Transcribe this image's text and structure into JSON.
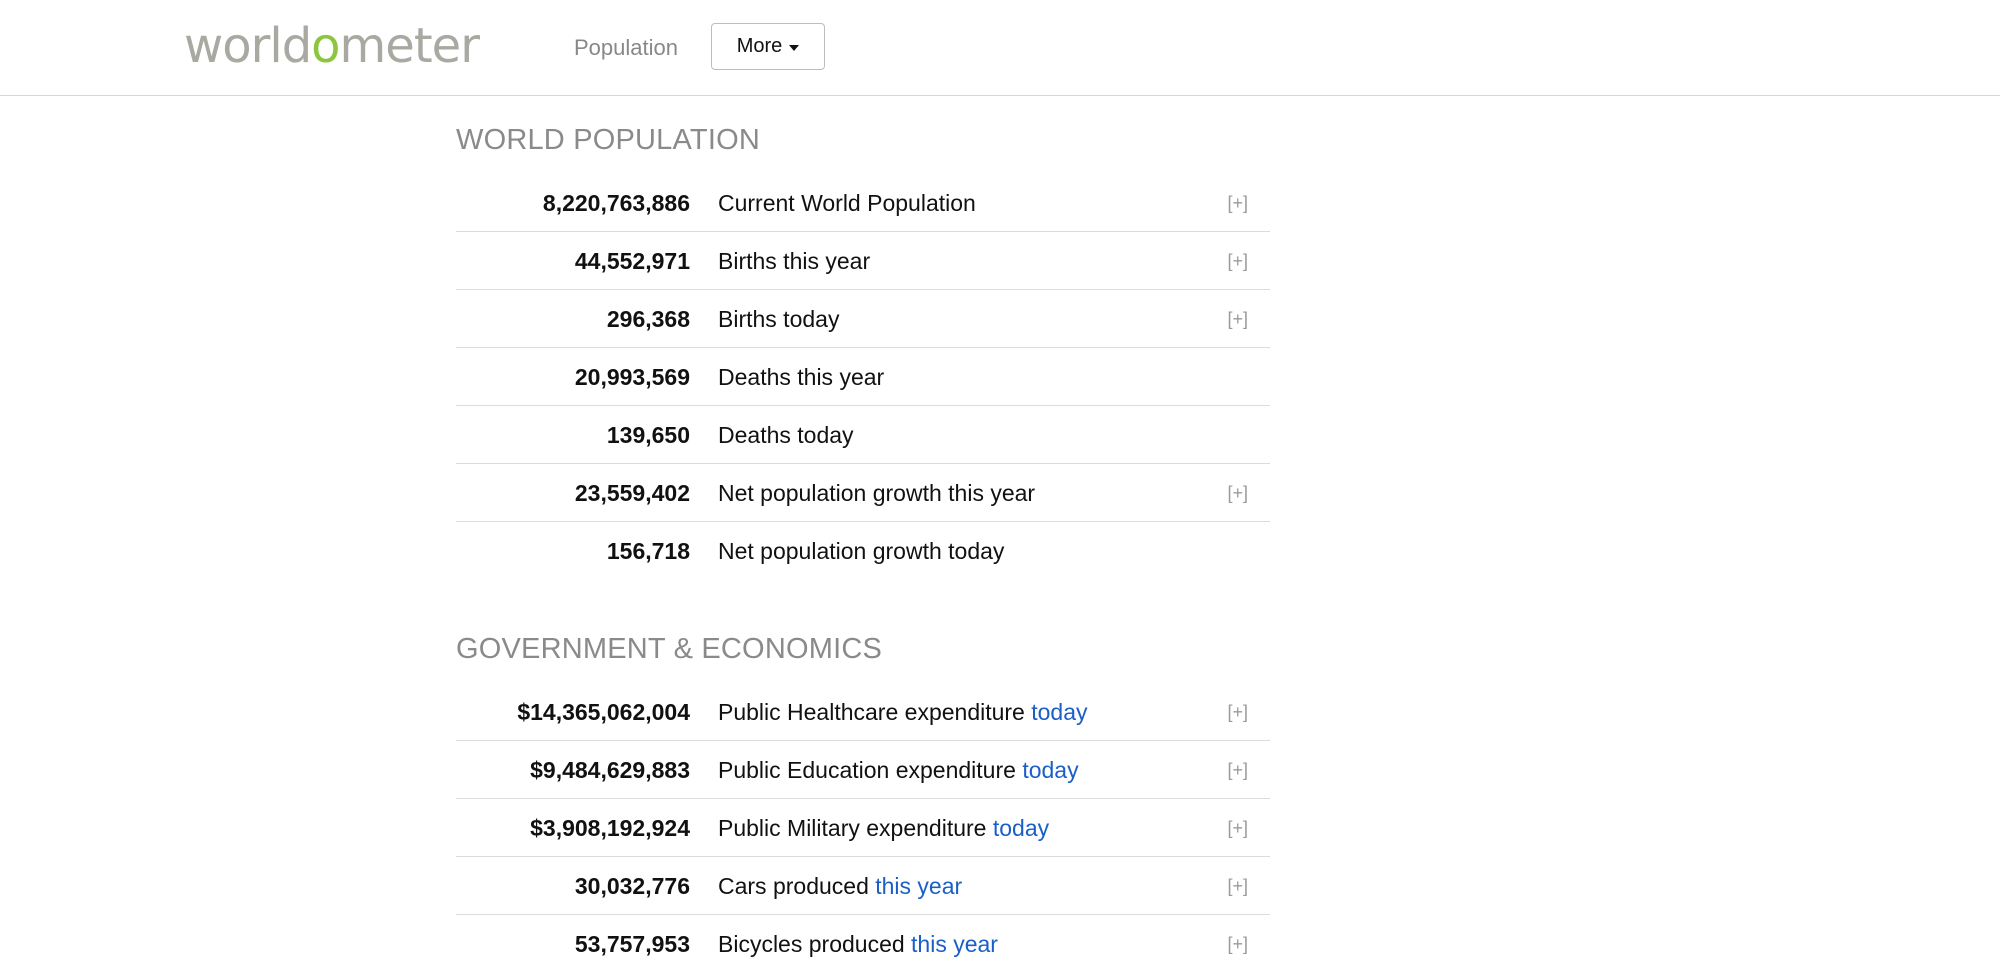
{
  "header": {
    "logo_part1": "worldo",
    "logo_part2": "meter",
    "nav_population": "Population",
    "more_label": "More"
  },
  "sections": {
    "population": {
      "title": "WORLD POPULATION",
      "rows": [
        {
          "value": "8,220,763,886",
          "label": "Current World Population",
          "suffix": "",
          "expand": "[+]"
        },
        {
          "value": "44,552,971",
          "label": "Births this year",
          "suffix": "",
          "expand": "[+]"
        },
        {
          "value": "296,368",
          "label": "Births today",
          "suffix": "",
          "expand": "[+]"
        },
        {
          "value": "20,993,569",
          "label": "Deaths this year",
          "suffix": "",
          "expand": ""
        },
        {
          "value": "139,650",
          "label": "Deaths today",
          "suffix": "",
          "expand": ""
        },
        {
          "value": "23,559,402",
          "label": "Net population growth this year",
          "suffix": "",
          "expand": "[+]"
        },
        {
          "value": "156,718",
          "label": "Net population growth today",
          "suffix": "",
          "expand": ""
        }
      ]
    },
    "economics": {
      "title": "GOVERNMENT & ECONOMICS",
      "rows": [
        {
          "value": "$14,365,062,004",
          "label": "Public Healthcare expenditure ",
          "suffix": "today",
          "expand": "[+]"
        },
        {
          "value": "$9,484,629,883",
          "label": "Public Education expenditure ",
          "suffix": "today",
          "expand": "[+]"
        },
        {
          "value": "$3,908,192,924",
          "label": "Public Military expenditure ",
          "suffix": "today",
          "expand": "[+]"
        },
        {
          "value": "30,032,776",
          "label": "Cars produced ",
          "suffix": "this year",
          "expand": "[+]"
        },
        {
          "value": "53,757,953",
          "label": "Bicycles produced ",
          "suffix": "this year",
          "expand": "[+]"
        }
      ]
    }
  }
}
